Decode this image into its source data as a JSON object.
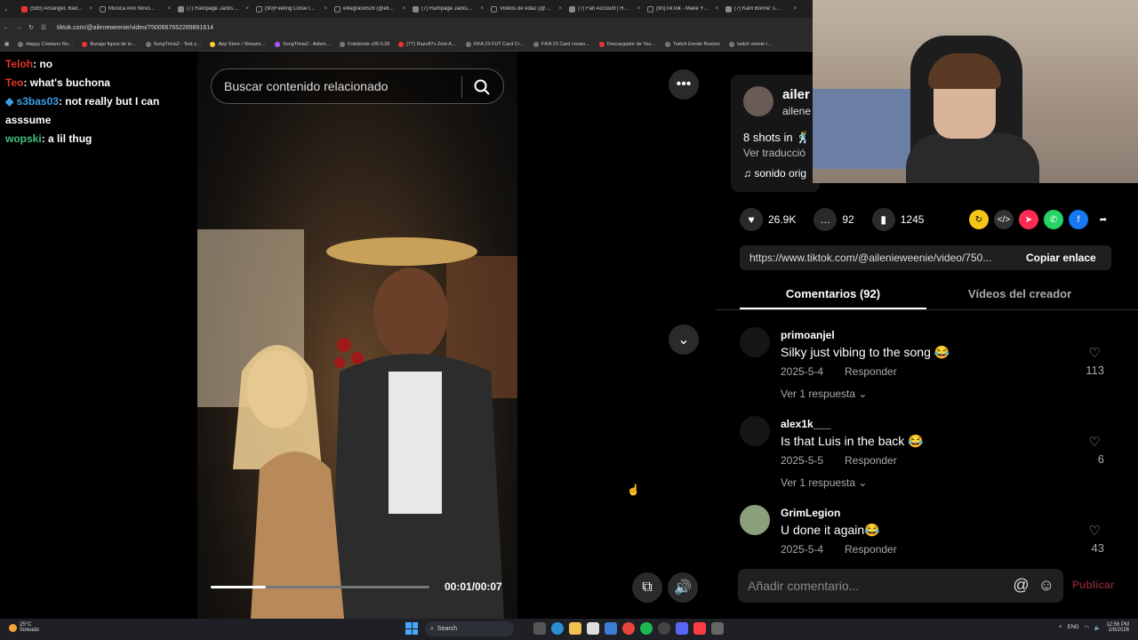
{
  "browser": {
    "tabs": [
      "(593) Arcangel, Bad…",
      "Musica Ano Novo…",
      "(7) Rampage Jacks…",
      "(90)Feeling Close t…",
      "elliegrace528 (@ell…",
      "(7) Rampage Jacks…",
      "Videos de eda2 (@…",
      "(7) Fan Account | R…",
      "(90)TikTok - Make Y…",
      "(7) Karli Bonne' s…"
    ],
    "url": "tiktok.com/@aileneweenie/video/7500667652289891614",
    "bookmarks": [
      "Happy Cristiano Ro…",
      "Burago figura de to…",
      "SongTrivia2 - Test y…",
      "App Store / Streami…",
      "SongTrivia2 - Adivin…",
      "Futeboots v26.0.28",
      "(77) Razo87s Zest-A…",
      "FIFA 23 FUT Card Cr…",
      "FIFA 23 Card creato…",
      "Descargador de You…",
      "Twitch Emote Resizer",
      "twitch emote r…"
    ]
  },
  "chat": [
    {
      "name": "Teloh",
      "text": ": no",
      "color": "#e0362e"
    },
    {
      "name": "Teo",
      "text": ": what's buchona",
      "color": "#e0362e"
    },
    {
      "name": "s3bas03",
      "text": ": not really but I can asssume",
      "color": "#3aa0e8"
    },
    {
      "name": "wopski",
      "text": ": a lil thug",
      "color": "#3fbf7f"
    }
  ],
  "video": {
    "search_placeholder": "Buscar contenido relacionado",
    "time": "00:01/00:07",
    "progress": 0.25
  },
  "author": {
    "name": "ailer",
    "handle": "ailene",
    "description": "8 shots in 🕺",
    "translate": "Ver traducció",
    "sound": "sonido orig"
  },
  "stats": {
    "likes": "26.9K",
    "comments": "92",
    "saves": "1245"
  },
  "link": {
    "url": "https://www.tiktok.com/@ailenieweenie/video/750...",
    "copy_label": "Copiar enlace"
  },
  "tabs": {
    "comments": "Comentarios (92)",
    "creator_videos": "Vídeos del creador"
  },
  "comments": [
    {
      "user": "primoanjel",
      "text": "Silky just vibing to the song 😂",
      "date": "2025-5-4",
      "reply": "Responder",
      "more": "Ver 1 respuesta ⌄",
      "likes": "113"
    },
    {
      "user": "alex1k___",
      "text": "Is that Luis in the back 😂",
      "date": "2025-5-5",
      "reply": "Responder",
      "more": "Ver 1 respuesta ⌄",
      "likes": "6"
    },
    {
      "user": "GrimLegion",
      "text": "U done it again😂",
      "date": "2025-5-4",
      "reply": "Responder",
      "more": "",
      "likes": "43"
    }
  ],
  "composer": {
    "placeholder": "Añadir comentario...",
    "publish": "Publicar"
  },
  "taskbar": {
    "temp": "25°C",
    "weather": "Soleado",
    "search": "Search",
    "lang": "ENG",
    "time": "12:56 PM",
    "date": "2/8/2026"
  }
}
